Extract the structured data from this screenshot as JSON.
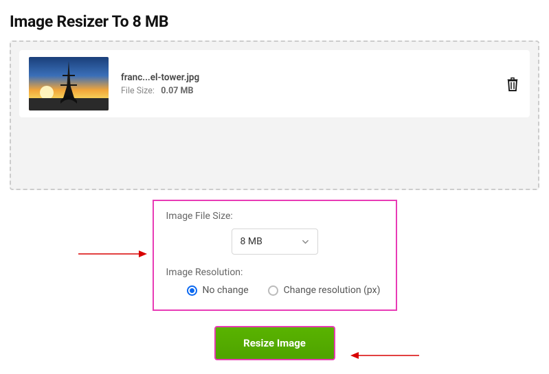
{
  "page": {
    "title": "Image Resizer To 8 MB"
  },
  "file": {
    "name": "franc...el-tower.jpg",
    "size_label": "File Size:",
    "size_value": "0.07 MB"
  },
  "options": {
    "filesize_label": "Image File Size:",
    "filesize_value": "8 MB",
    "resolution_label": "Image Resolution:",
    "radio_nochange": "No change",
    "radio_change": "Change resolution (px)"
  },
  "actions": {
    "resize_button": "Resize Image"
  },
  "annotation": {
    "highlight_color": "#e83ab5",
    "arrow_color": "#d80000"
  }
}
